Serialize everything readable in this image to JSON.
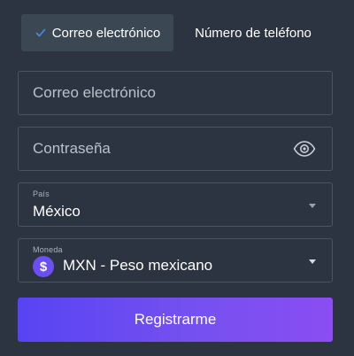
{
  "tabs": {
    "email_label": "Correo electrónico",
    "phone_label": "Número de teléfono",
    "active": "email"
  },
  "email_field": {
    "placeholder": "Correo electrónico",
    "value": ""
  },
  "password_field": {
    "placeholder": "Contraseña",
    "value": "",
    "toggle_icon": "eye-icon"
  },
  "country_select": {
    "label": "País",
    "value": "México"
  },
  "currency_select": {
    "label": "Moneda",
    "value": "MXN - Peso mexicano",
    "icon_glyph": "$"
  },
  "submit": {
    "label": "Registrarme"
  },
  "colors": {
    "background": "#2b3440",
    "accent": "#6b4ff5",
    "field_border": "#4a5562"
  }
}
